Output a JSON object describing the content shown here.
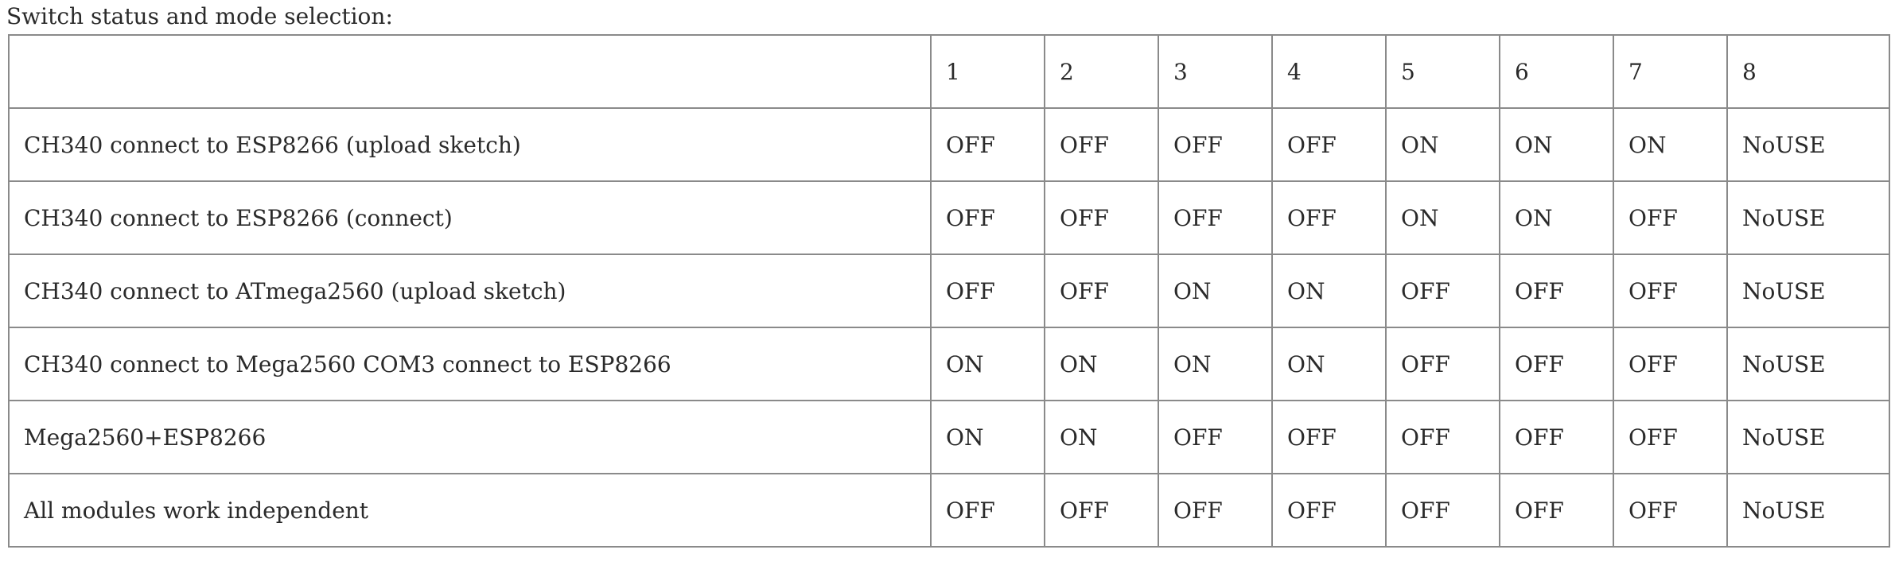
{
  "caption": "Switch status and mode selection:",
  "table": {
    "header": [
      "",
      "1",
      "2",
      "3",
      "4",
      "5",
      "6",
      "7",
      "8"
    ],
    "rows": [
      {
        "mode": "CH340 connect to ESP8266 (upload sketch)",
        "switches": [
          "OFF",
          "OFF",
          "OFF",
          "OFF",
          "ON",
          "ON",
          "ON",
          "NoUSE"
        ]
      },
      {
        "mode": "CH340 connect to ESP8266 (connect)",
        "switches": [
          "OFF",
          "OFF",
          "OFF",
          "OFF",
          "ON",
          "ON",
          "OFF",
          "NoUSE"
        ]
      },
      {
        "mode": "CH340 connect to ATmega2560 (upload sketch)",
        "switches": [
          "OFF",
          "OFF",
          "ON",
          "ON",
          "OFF",
          "OFF",
          "OFF",
          "NoUSE"
        ]
      },
      {
        "mode": "CH340 connect to Mega2560 COM3 connect to ESP8266",
        "switches": [
          "ON",
          "ON",
          "ON",
          "ON",
          "OFF",
          "OFF",
          "OFF",
          "NoUSE"
        ]
      },
      {
        "mode": "Mega2560+ESP8266",
        "switches": [
          "ON",
          "ON",
          "OFF",
          "OFF",
          "OFF",
          "OFF",
          "OFF",
          "NoUSE"
        ]
      },
      {
        "mode": "All modules work independent",
        "switches": [
          "OFF",
          "OFF",
          "OFF",
          "OFF",
          "OFF",
          "OFF",
          "OFF",
          "NoUSE"
        ]
      }
    ]
  }
}
